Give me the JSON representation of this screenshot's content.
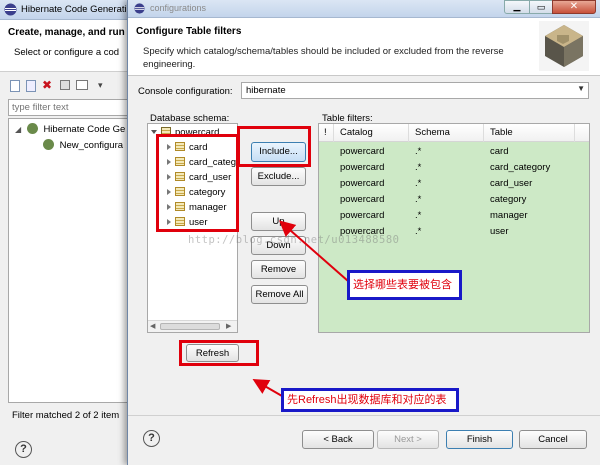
{
  "back_window": {
    "title": "Hibernate Code Generati",
    "header": "Create, manage, and run c",
    "subheader": "Select or configure a cod",
    "filter_placeholder": "type filter text",
    "tree": [
      {
        "label": "Hibernate Code Ge"
      },
      {
        "label": "New_configura"
      }
    ],
    "status": "Filter matched 2 of 2 item"
  },
  "dialog": {
    "title": "configurations",
    "header": "Configure Table filters",
    "description": "Specify which catalog/schema/tables should be included or excluded from the reverse engineering.",
    "console_label": "Console configuration:",
    "console_value": "hibernate",
    "schema_label": "Database schema:",
    "schema_root": "powercard",
    "schema_tables": [
      "card",
      "card_categ",
      "card_user",
      "category",
      "manager",
      "user"
    ],
    "filters_label": "Table filters:",
    "columns": [
      "!",
      "Catalog",
      "Schema",
      "Table"
    ],
    "rows": [
      {
        "catalog": "powercard",
        "schema": ".*",
        "table": "card"
      },
      {
        "catalog": "powercard",
        "schema": ".*",
        "table": "card_category"
      },
      {
        "catalog": "powercard",
        "schema": ".*",
        "table": "card_user"
      },
      {
        "catalog": "powercard",
        "schema": ".*",
        "table": "category"
      },
      {
        "catalog": "powercard",
        "schema": ".*",
        "table": "manager"
      },
      {
        "catalog": "powercard",
        "schema": ".*",
        "table": "user"
      }
    ],
    "buttons": {
      "include": "Include...",
      "exclude": "Exclude...",
      "up": "Up",
      "down": "Down",
      "remove": "Remove",
      "remove_all": "Remove All",
      "refresh": "Refresh"
    },
    "footer": {
      "help": "?",
      "back": "< Back",
      "next": "Next >",
      "finish": "Finish",
      "cancel": "Cancel"
    },
    "watermark": "http://blog.csdn.net/u013488580"
  },
  "annotations": {
    "include_note": "选择哪些表要被包含",
    "refresh_note": "先Refresh出现数据库和对应的表"
  },
  "colors": {
    "filter_bg": "#cde9c6",
    "annotation_red": "#e0000c",
    "annotation_blue": "#1919c8",
    "selection": "#cfe3f8"
  }
}
